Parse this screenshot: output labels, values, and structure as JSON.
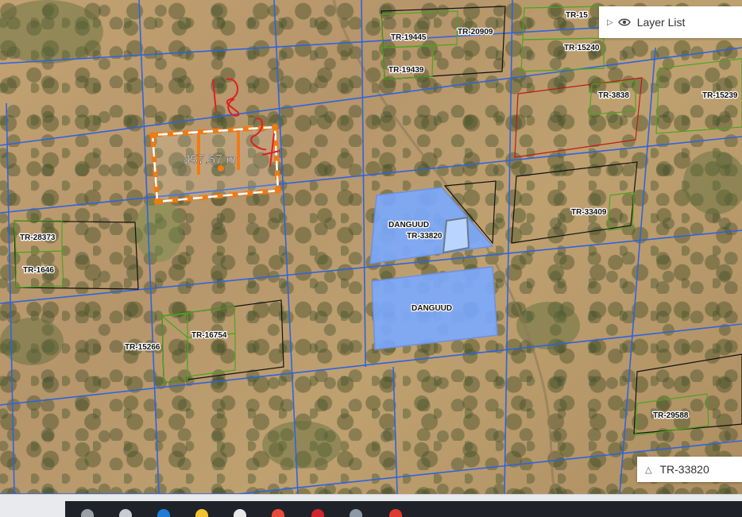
{
  "map": {
    "measurement": "457.57 m",
    "annotation": "18 24",
    "plots": [
      {
        "id": "TR-19445"
      },
      {
        "id": "TR-20909"
      },
      {
        "id": "TR-19439"
      },
      {
        "id": "TR-15"
      },
      {
        "id": "TR-15240"
      },
      {
        "id": "TR-3838"
      },
      {
        "id": "TR-15239"
      },
      {
        "id": "TR-33409"
      },
      {
        "id": "TR-28373"
      },
      {
        "id": "TR-1646"
      },
      {
        "id": "TR-15266"
      },
      {
        "id": "TR-16754"
      },
      {
        "id": "TR-29588"
      },
      {
        "id": "DANGUUD"
      },
      {
        "id": "TR-33820"
      },
      {
        "id": "DANGUUD"
      }
    ],
    "colors": {
      "grid": "#2f63e0",
      "parcel_green": "#4aa51c",
      "parcel_black": "#111111",
      "parcel_red": "#c01818",
      "selected_fill": "#7aaaff",
      "measure": "#f07a16"
    }
  },
  "layer_list": {
    "label": "Layer List",
    "icons": [
      "expand-arrow-icon",
      "eye-icon"
    ]
  },
  "search": {
    "value": "TR-33820",
    "icon": "chevron-up-icon"
  },
  "taskbar": {
    "icons": [
      "search-icon",
      "task-view-icon",
      "edge-icon",
      "file-explorer-icon",
      "store-icon",
      "settings-icon",
      "opera-icon",
      "photos-icon",
      "chrome-icon"
    ]
  }
}
